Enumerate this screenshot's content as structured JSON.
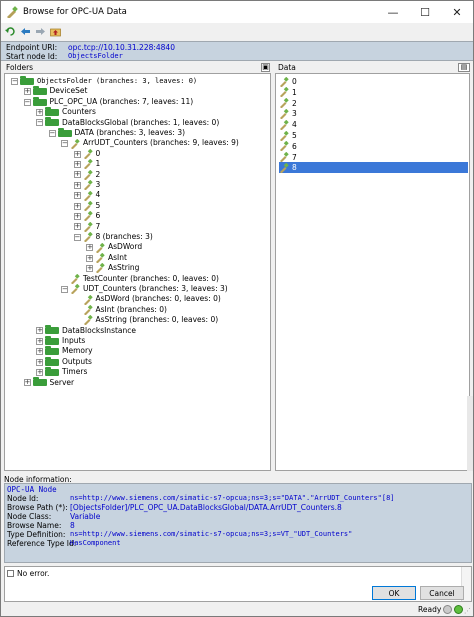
{
  "window": {
    "title": "Browse for OPC-UA Data",
    "minimize": "—",
    "maximize": "☐",
    "close": "✕"
  },
  "endpoint": {
    "uri_label": "Endpoint URI:",
    "uri_value": "opc.tcp://10.10.31.228:4840",
    "start_label": "Start node Id:",
    "start_value": "ObjectsFolder"
  },
  "folders": {
    "header": "Folders",
    "tree": [
      {
        "label": "ObjectsFolder (branches: 3, leaves: 0)",
        "level": 0,
        "expander": "-",
        "icon": "folder",
        "mono": true
      },
      {
        "label": "DeviceSet",
        "level": 1,
        "expander": "+",
        "icon": "folder"
      },
      {
        "label": "PLC_OPC_UA (branches: 7, leaves: 11)",
        "level": 1,
        "expander": "-",
        "icon": "folder"
      },
      {
        "label": "Counters",
        "level": 2,
        "expander": "+",
        "icon": "folder"
      },
      {
        "label": "DataBlocksGlobal (branches: 1, leaves: 0)",
        "level": 2,
        "expander": "-",
        "icon": "folder"
      },
      {
        "label": "DATA (branches: 3, leaves: 3)",
        "level": 3,
        "expander": "-",
        "icon": "folder"
      },
      {
        "label": "ArrUDT_Counters (branches: 9, leaves: 9)",
        "level": 4,
        "expander": "-",
        "icon": "var"
      },
      {
        "label": "0",
        "level": 5,
        "expander": "+",
        "icon": "var"
      },
      {
        "label": "1",
        "level": 5,
        "expander": "+",
        "icon": "var"
      },
      {
        "label": "2",
        "level": 5,
        "expander": "+",
        "icon": "var"
      },
      {
        "label": "3",
        "level": 5,
        "expander": "+",
        "icon": "var"
      },
      {
        "label": "4",
        "level": 5,
        "expander": "+",
        "icon": "var"
      },
      {
        "label": "5",
        "level": 5,
        "expander": "+",
        "icon": "var"
      },
      {
        "label": "6",
        "level": 5,
        "expander": "+",
        "icon": "var"
      },
      {
        "label": "7",
        "level": 5,
        "expander": "+",
        "icon": "var"
      },
      {
        "label": "8 (branches: 3)",
        "level": 5,
        "expander": "-",
        "icon": "var"
      },
      {
        "label": "AsDWord",
        "level": 6,
        "expander": "+",
        "icon": "var"
      },
      {
        "label": "AsInt",
        "level": 6,
        "expander": "+",
        "icon": "var"
      },
      {
        "label": "AsString",
        "level": 6,
        "expander": "+",
        "icon": "var"
      },
      {
        "label": "TestCounter (branches: 0, leaves: 0)",
        "level": 4,
        "expander": "",
        "icon": "var"
      },
      {
        "label": "UDT_Counters (branches: 3, leaves: 3)",
        "level": 4,
        "expander": "-",
        "icon": "var"
      },
      {
        "label": "AsDWord (branches: 0, leaves: 0)",
        "level": 5,
        "expander": "",
        "icon": "var"
      },
      {
        "label": "AsInt (branches: 0)",
        "level": 5,
        "expander": "",
        "icon": "var"
      },
      {
        "label": "AsString (branches: 0, leaves: 0)",
        "level": 5,
        "expander": "",
        "icon": "var"
      },
      {
        "label": "DataBlocksInstance",
        "level": 2,
        "expander": "+",
        "icon": "folder"
      },
      {
        "label": "Inputs",
        "level": 2,
        "expander": "+",
        "icon": "folder"
      },
      {
        "label": "Memory",
        "level": 2,
        "expander": "+",
        "icon": "folder"
      },
      {
        "label": "Outputs",
        "level": 2,
        "expander": "+",
        "icon": "folder"
      },
      {
        "label": "Timers",
        "level": 2,
        "expander": "+",
        "icon": "folder"
      },
      {
        "label": "Server",
        "level": 1,
        "expander": "+",
        "icon": "folder"
      }
    ]
  },
  "data_pane": {
    "header": "Data",
    "items": [
      "0",
      "1",
      "2",
      "3",
      "4",
      "5",
      "6",
      "7",
      "8"
    ],
    "selected_index": 8
  },
  "node_info": {
    "header": "Node information:",
    "title": "OPC-UA Node",
    "rows": [
      {
        "label": "Node Id:",
        "value": "ns=http://www.siemens.com/simatic-s7-opcua;ns=3;s=\"DATA\".\"ArrUDT_Counters\"[8]",
        "mono": true
      },
      {
        "label": "Browse Path (*):",
        "value": "[ObjectsFolder]/PLC_OPC_UA.DataBlocksGlobal/DATA.ArrUDT_Counters.8",
        "mono": false
      },
      {
        "label": "Node Class:",
        "value": "Variable",
        "mono": false
      },
      {
        "label": "Browse Name:",
        "value": "8",
        "mono": false
      },
      {
        "label": "Type Definition:",
        "value": "ns=http://www.siemens.com/simatic-s7-opcua;ns=3;s=VT_\"UDT_Counters\"",
        "mono": true
      },
      {
        "label": "Reference Type Id:",
        "value": "HasComponent",
        "mono": true
      }
    ]
  },
  "status": {
    "message": "No error."
  },
  "buttons": {
    "ok": "OK",
    "cancel": "Cancel"
  },
  "footer": {
    "ready": "Ready"
  },
  "colors": {
    "accent": "#3b78d8",
    "info_bg": "#c7d3df",
    "link_blue": "#0000cc",
    "folder_green": "#3a9d3a"
  }
}
